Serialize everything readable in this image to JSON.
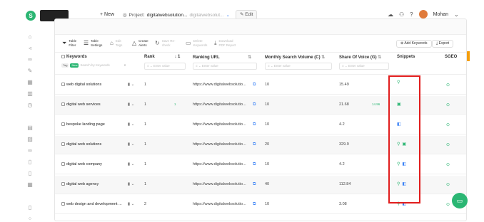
{
  "topbar": {
    "logo_letter": "S",
    "logo_text": "",
    "new_label": "New",
    "project_label": "Project:",
    "project_value": "digitalwebsolution...",
    "project_url": "digitalwebsolut...",
    "edit_label": "Edit",
    "user_name": "Mohan"
  },
  "toolbar": {
    "tools": [
      {
        "label": "Table Filter",
        "icon": "filter-icon",
        "active": true
      },
      {
        "label": "Table Settings",
        "icon": "settings-icon",
        "active": true
      },
      {
        "label": "Edit Tags",
        "icon": "tag-icon",
        "active": false
      },
      {
        "label": "Create Alerts",
        "icon": "alert-icon",
        "active": true
      },
      {
        "label": "Save Re-check",
        "icon": "recheck-icon",
        "active": false
      },
      {
        "label": "Delete Keywords",
        "icon": "delete-icon",
        "active": false
      },
      {
        "label": "Download PDF Report",
        "icon": "download-icon",
        "active": false
      }
    ],
    "add_keywords_label": "Add Keywords",
    "export_label": "Export"
  },
  "table": {
    "columns": {
      "keywords": "Keywords",
      "rank": "Rank",
      "rank_sort": "1",
      "ranking_url": "Ranking URL",
      "msv": "Monthly Search Volume (C)",
      "sov": "Share Of Voice (G)",
      "snippets": "Snippets",
      "sgeo": "SGEO"
    },
    "filters": {
      "search_keywords": "Search by Keywords",
      "rank": "Enter value",
      "url": "Enter value",
      "msv": "Enter value",
      "sov": "Enter value"
    },
    "tag_pills": [
      "Tag",
      "New"
    ],
    "rows": [
      {
        "keyword": "web digital solutions",
        "rank": "1",
        "url": "https://www.digitalwebsolutio...",
        "msv": "10",
        "sov": "15.49",
        "rank_change": "",
        "sov_change": "",
        "snippets": [
          "pin"
        ]
      },
      {
        "keyword": "digital web services",
        "rank": "1",
        "url": "https://www.digitalwebsolutio...",
        "msv": "10",
        "sov": "21.68",
        "rank_change": "1",
        "sov_change": "14.96",
        "snippets": [
          "image"
        ]
      },
      {
        "keyword": "bespoke landing page",
        "rank": "1",
        "url": "https://www.digitalwebsolutio...",
        "msv": "10",
        "sov": "4.2",
        "rank_change": "",
        "sov_change": "",
        "snippets": [
          "video"
        ]
      },
      {
        "keyword": "digital web solutions",
        "rank": "1",
        "url": "https://www.digitalwebsolutio...",
        "msv": "20",
        "sov": "329.9",
        "rank_change": "",
        "sov_change": "",
        "snippets": [
          "pin",
          "image"
        ]
      },
      {
        "keyword": "digital web company",
        "rank": "1",
        "url": "https://www.digitalwebsolutio...",
        "msv": "10",
        "sov": "4.2",
        "rank_change": "",
        "sov_change": "",
        "snippets": [
          "pin",
          "video"
        ]
      },
      {
        "keyword": "digital web agency",
        "rank": "1",
        "url": "https://www.digitalwebsolutio...",
        "msv": "40",
        "sov": "112.84",
        "rank_change": "",
        "sov_change": "",
        "snippets": [
          "pin",
          "video"
        ]
      },
      {
        "keyword": "web design and development ...",
        "rank": "2",
        "url": "https://www.digitalwebsolutio...",
        "msv": "10",
        "sov": "3.08",
        "rank_change": "",
        "sov_change": "",
        "snippets": [
          "pin",
          "video"
        ]
      }
    ]
  },
  "colors": {
    "accent": "#2bb673",
    "highlight": "#e11d1d",
    "link": "#3b82f6"
  }
}
